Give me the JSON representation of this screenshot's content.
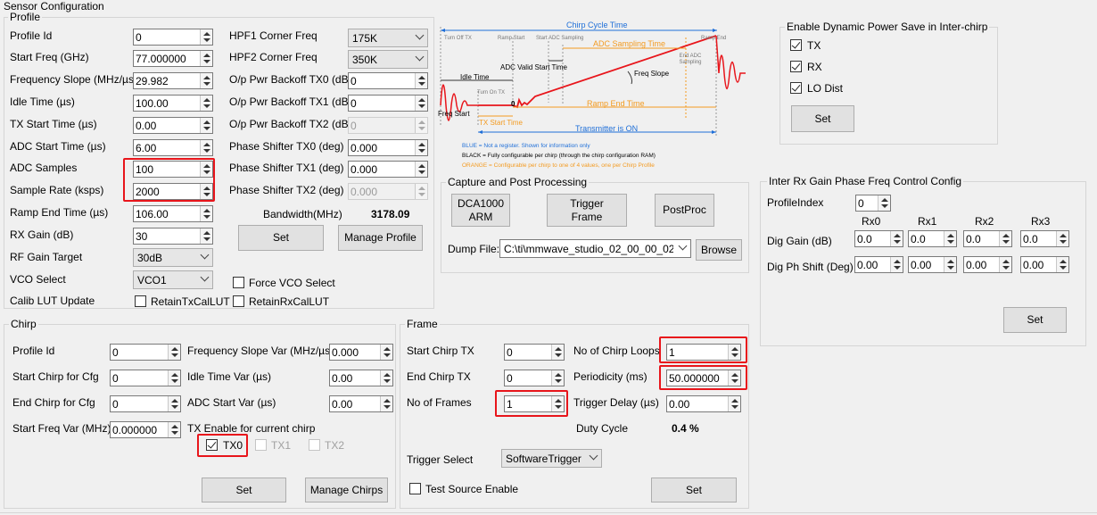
{
  "window_title": "Sensor Configuration",
  "profile": {
    "title": "Profile",
    "fields": {
      "profile_id": {
        "label": "Profile Id",
        "value": "0"
      },
      "start_freq": {
        "label": "Start Freq (GHz)",
        "value": "77.000000"
      },
      "freq_slope": {
        "label": "Frequency Slope (MHz/µs)",
        "value": "29.982"
      },
      "idle_time": {
        "label": "Idle Time (µs)",
        "value": "100.00"
      },
      "tx_start_time": {
        "label": "TX Start Time (µs)",
        "value": "0.00"
      },
      "adc_start_time": {
        "label": "ADC Start Time (µs)",
        "value": "6.00"
      },
      "adc_samples": {
        "label": "ADC Samples",
        "value": "100"
      },
      "sample_rate": {
        "label": "Sample Rate (ksps)",
        "value": "2000"
      },
      "ramp_end_time": {
        "label": "Ramp End Time (µs)",
        "value": "106.00"
      },
      "rx_gain": {
        "label": "RX Gain (dB)",
        "value": "30"
      },
      "rf_gain_target": {
        "label": "RF Gain Target",
        "value": "30dB"
      },
      "vco_select": {
        "label": "VCO Select",
        "value": "VCO1"
      },
      "calib_lut_update": {
        "label": "Calib LUT Update"
      },
      "hpf1": {
        "label": "HPF1 Corner Freq",
        "value": "175K"
      },
      "hpf2": {
        "label": "HPF2 Corner Freq",
        "value": "350K"
      },
      "pwr_backoff_tx0": {
        "label": "O/p Pwr Backoff TX0 (dB)",
        "value": "0"
      },
      "pwr_backoff_tx1": {
        "label": "O/p Pwr Backoff TX1 (dB)",
        "value": "0"
      },
      "pwr_backoff_tx2": {
        "label": "O/p Pwr Backoff TX2 (dB)",
        "value": "0"
      },
      "phase_tx0": {
        "label": "Phase Shifter TX0 (deg)",
        "value": "0.000"
      },
      "phase_tx1": {
        "label": "Phase Shifter TX1 (deg)",
        "value": "0.000"
      },
      "phase_tx2": {
        "label": "Phase Shifter TX2 (deg)",
        "value": "0.000"
      }
    },
    "bandwidth_label": "Bandwidth(MHz)",
    "bandwidth_value": "3178.09",
    "set_label": "Set",
    "manage_label": "Manage Profile",
    "force_vco_label": "Force VCO Select",
    "retain_tx_label": "RetainTxCalLUT",
    "retain_rx_label": "RetainRxCalLUT"
  },
  "diagram": {
    "chirp_cycle_time": "Chirp Cycle Time",
    "turn_off_tx": "Turn Off TX",
    "ramp_start": "Ramp Start",
    "start_adc_sampling": "Start ADC Sampling",
    "adc_sampling_time": "ADC Sampling Time",
    "ramp_end": "Ramp End",
    "end_adc_sampling": "End ADC Sampling",
    "adc_valid_start_time": "ADC Valid Start Time",
    "freq_slope": "Freq Slope",
    "idle_time": "Idle Time",
    "turn_on_tx": "Turn On TX",
    "zero": "0",
    "ramp_end_time": "Ramp End Time",
    "freq_start": "Freq Start",
    "tx_start_time": "TX Start Time",
    "transmitter_on": "Transmitter is ON",
    "legend_blue": "BLUE = Not a register. Shown for information only",
    "legend_black": "BLACK = Fully configurable per chirp (through the chirp configuration RAM)",
    "legend_orange": "ORANGE = Configurable per chirp to one of 4 values, one per Chirp Profile"
  },
  "capture": {
    "title": "Capture and Post Processing",
    "dca_label_1": "DCA1000",
    "dca_label_2": "ARM",
    "trigger_label_1": "Trigger",
    "trigger_label_2": "Frame",
    "postproc_label": "PostProc",
    "dump_file_label": "Dump File:",
    "dump_file_value": "C:\\ti\\mmwave_studio_02_00_00_02",
    "browse_label": "Browse"
  },
  "power_save": {
    "title": "Enable Dynamic Power Save in Inter-chirp",
    "tx_label": "TX",
    "rx_label": "RX",
    "lo_dist_label": "LO Dist",
    "set_label": "Set"
  },
  "inter_rx": {
    "title": "Inter Rx Gain Phase Freq Control Config",
    "profile_index_label": "ProfileIndex",
    "profile_index_value": "0",
    "cols": [
      "Rx0",
      "Rx1",
      "Rx2",
      "Rx3"
    ],
    "dig_gain_label": "Dig Gain (dB)",
    "dig_gain_values": [
      "0.0",
      "0.0",
      "0.0",
      "0.0"
    ],
    "dig_phase_label": "Dig Ph Shift (Deg)",
    "dig_phase_values": [
      "0.00",
      "0.00",
      "0.00",
      "0.00"
    ],
    "set_label": "Set"
  },
  "chirp": {
    "title": "Chirp",
    "profile_id": {
      "label": "Profile Id",
      "value": "0"
    },
    "start_chirp": {
      "label": "Start Chirp for Cfg",
      "value": "0"
    },
    "end_chirp": {
      "label": "End Chirp for Cfg",
      "value": "0"
    },
    "start_freq_var": {
      "label": "Start Freq Var (MHz)",
      "value": "0.000000"
    },
    "freq_slope_var": {
      "label": "Frequency Slope Var (MHz/µs)",
      "value": "0.000"
    },
    "idle_time_var": {
      "label": "Idle Time Var (µs)",
      "value": "0.00"
    },
    "adc_start_var": {
      "label": "ADC Start Var (µs)",
      "value": "0.00"
    },
    "tx_enable_label": "TX Enable for current chirp",
    "tx0_label": "TX0",
    "tx1_label": "TX1",
    "tx2_label": "TX2",
    "set_label": "Set",
    "manage_label": "Manage Chirps"
  },
  "frame": {
    "title": "Frame",
    "start_chirp_tx": {
      "label": "Start Chirp TX",
      "value": "0"
    },
    "end_chirp_tx": {
      "label": "End Chirp TX",
      "value": "0"
    },
    "num_frames": {
      "label": "No of Frames",
      "value": "1"
    },
    "num_loops": {
      "label": "No of Chirp Loops",
      "value": "1"
    },
    "periodicity": {
      "label": "Periodicity (ms)",
      "value": "50.000000"
    },
    "trigger_delay": {
      "label": "Trigger Delay (µs)",
      "value": "0.00"
    },
    "duty_cycle_label": "Duty Cycle",
    "duty_cycle_value": "0.4 %",
    "trigger_select_label": "Trigger Select",
    "trigger_select_value": "SoftwareTrigger",
    "test_source_label": "Test Source Enable",
    "set_label": "Set"
  },
  "colors": {
    "highlight": "#e8151b",
    "diagram_red": "#e8151b",
    "diagram_blue": "#1f6fd8",
    "diagram_orange": "#f39a1f"
  }
}
